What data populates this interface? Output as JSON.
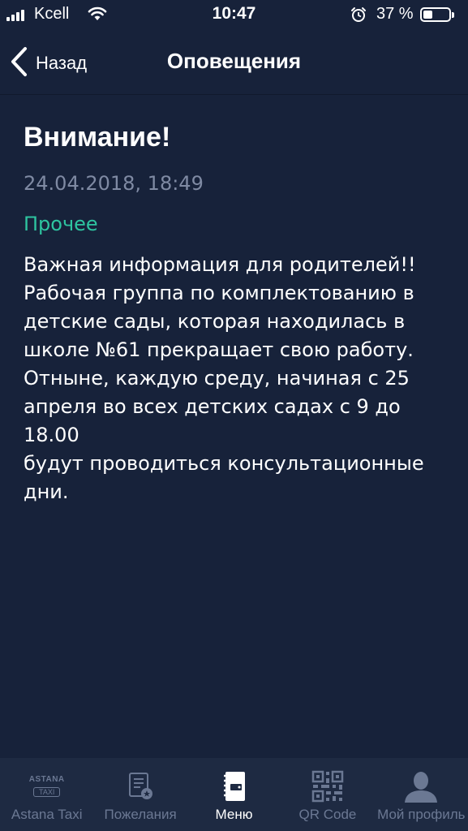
{
  "status_bar": {
    "carrier": "Kcell",
    "time": "10:47",
    "battery_percent": "37 %",
    "battery_level": 0.37
  },
  "nav": {
    "back_label": "Назад",
    "title": "Оповещения"
  },
  "notification": {
    "headline": "Внимание!",
    "date": "24.04.2018, 18:49",
    "category": "Прочее",
    "category_color": "#2ec4a0",
    "body": "Важная информация для родителей!!\nРабочая группа по комплектованию в\nдетские сады, которая находилась в\nшколе №61 прекращает свою работу.\nОтныне, каждую среду, начиная с 25\nапреля во всех детских садах с 9 до 18.00\nбудут проводиться консультационные\nдни."
  },
  "tab_bar": {
    "items": [
      {
        "label": "Astana Taxi",
        "icon": "astana-taxi-logo",
        "logo_top": "ASTANA",
        "logo_bottom": "TAXI",
        "active": false
      },
      {
        "label": "Пожелания",
        "icon": "feedback-doc-icon",
        "active": false
      },
      {
        "label": "Меню",
        "icon": "menu-book-icon",
        "active": true
      },
      {
        "label": "QR Code",
        "icon": "qr-code-icon",
        "active": false
      },
      {
        "label": "Мой профиль",
        "icon": "profile-icon",
        "active": false
      }
    ]
  }
}
